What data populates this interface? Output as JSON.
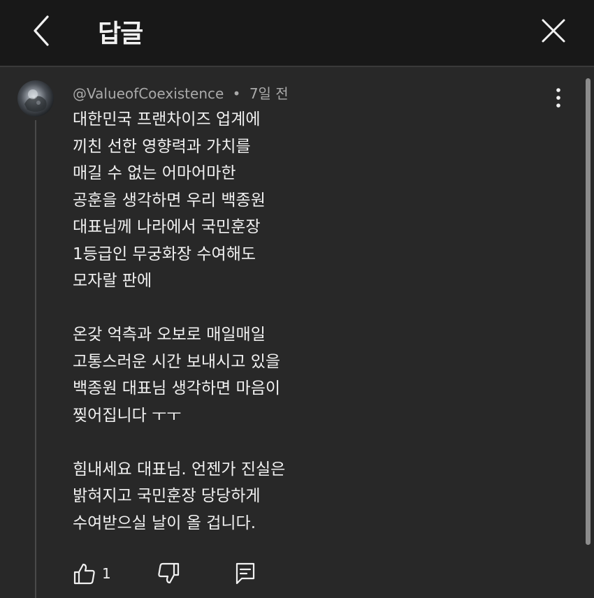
{
  "header": {
    "title": "답글",
    "back_icon": "chevron-left-icon",
    "close_icon": "close-icon"
  },
  "comment": {
    "author": "@ValueofCoexistence",
    "separator": "•",
    "time": "7일 전",
    "lines": [
      "대한민국 프랜차이즈 업계에",
      "끼친 선한 영향력과 가치를",
      "매길 수 없는 어마어마한",
      "공훈을 생각하면 우리 백종원",
      "대표님께 나라에서 국민훈장",
      "1등급인 무궁화장 수여해도",
      "모자랄 판에",
      "",
      "온갖 억측과 오보로 매일매일",
      "고통스러운 시간 보내시고 있을",
      "백종원 대표님 생각하면 마음이",
      "찢어집니다 ㅜㅜ",
      "",
      "힘내세요 대표님. 언젠가 진실은",
      "밝혀지고 국민훈장 당당하게",
      "수여받으실 날이 올 겁니다."
    ],
    "like_count": "1"
  },
  "colors": {
    "background": "#282828",
    "header_background": "#181818",
    "text": "#f1f1f1",
    "meta_text": "#aaaaaa"
  }
}
